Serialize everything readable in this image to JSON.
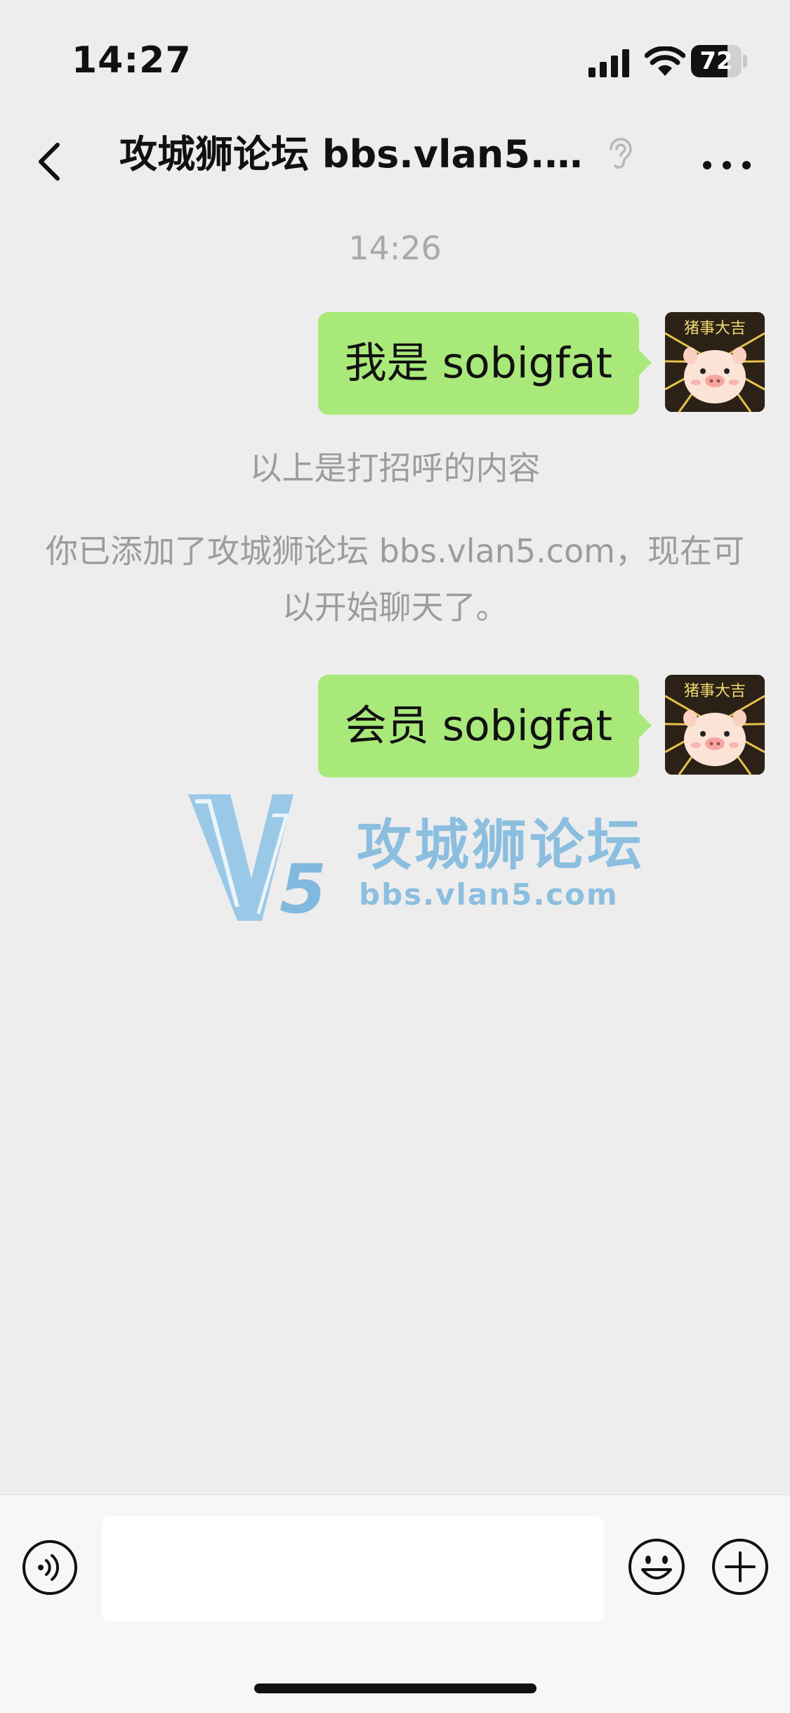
{
  "status_bar": {
    "time": "14:27",
    "battery": "72",
    "battery_level": 0.72
  },
  "nav": {
    "title": "攻城狮论坛 bbs.vlan5.com"
  },
  "chat": {
    "timestamp": "14:26",
    "messages": [
      {
        "text": "我是 sobigfat"
      },
      {
        "text": "会员 sobigfat"
      }
    ],
    "system_messages": [
      "以上是打招呼的内容",
      "你已添加了攻城狮论坛 bbs.vlan5.com，现在可以开始聊天了。"
    ]
  },
  "avatar": {
    "caption": "猪事大吉"
  },
  "watermark": {
    "logo": "V5",
    "title": "攻城狮论坛",
    "url": "bbs.vlan5.com"
  },
  "input": {
    "value": "",
    "placeholder": ""
  },
  "icons": {
    "back": "chevron-left-icon",
    "mute": "ear-icon",
    "more": "more-dots-icon",
    "voice": "voice-icon",
    "emoji": "emoji-icon",
    "plus": "plus-icon"
  },
  "colors": {
    "bubble": "#a9e97a",
    "background": "#ededed",
    "watermark": "#7ab6dd"
  }
}
